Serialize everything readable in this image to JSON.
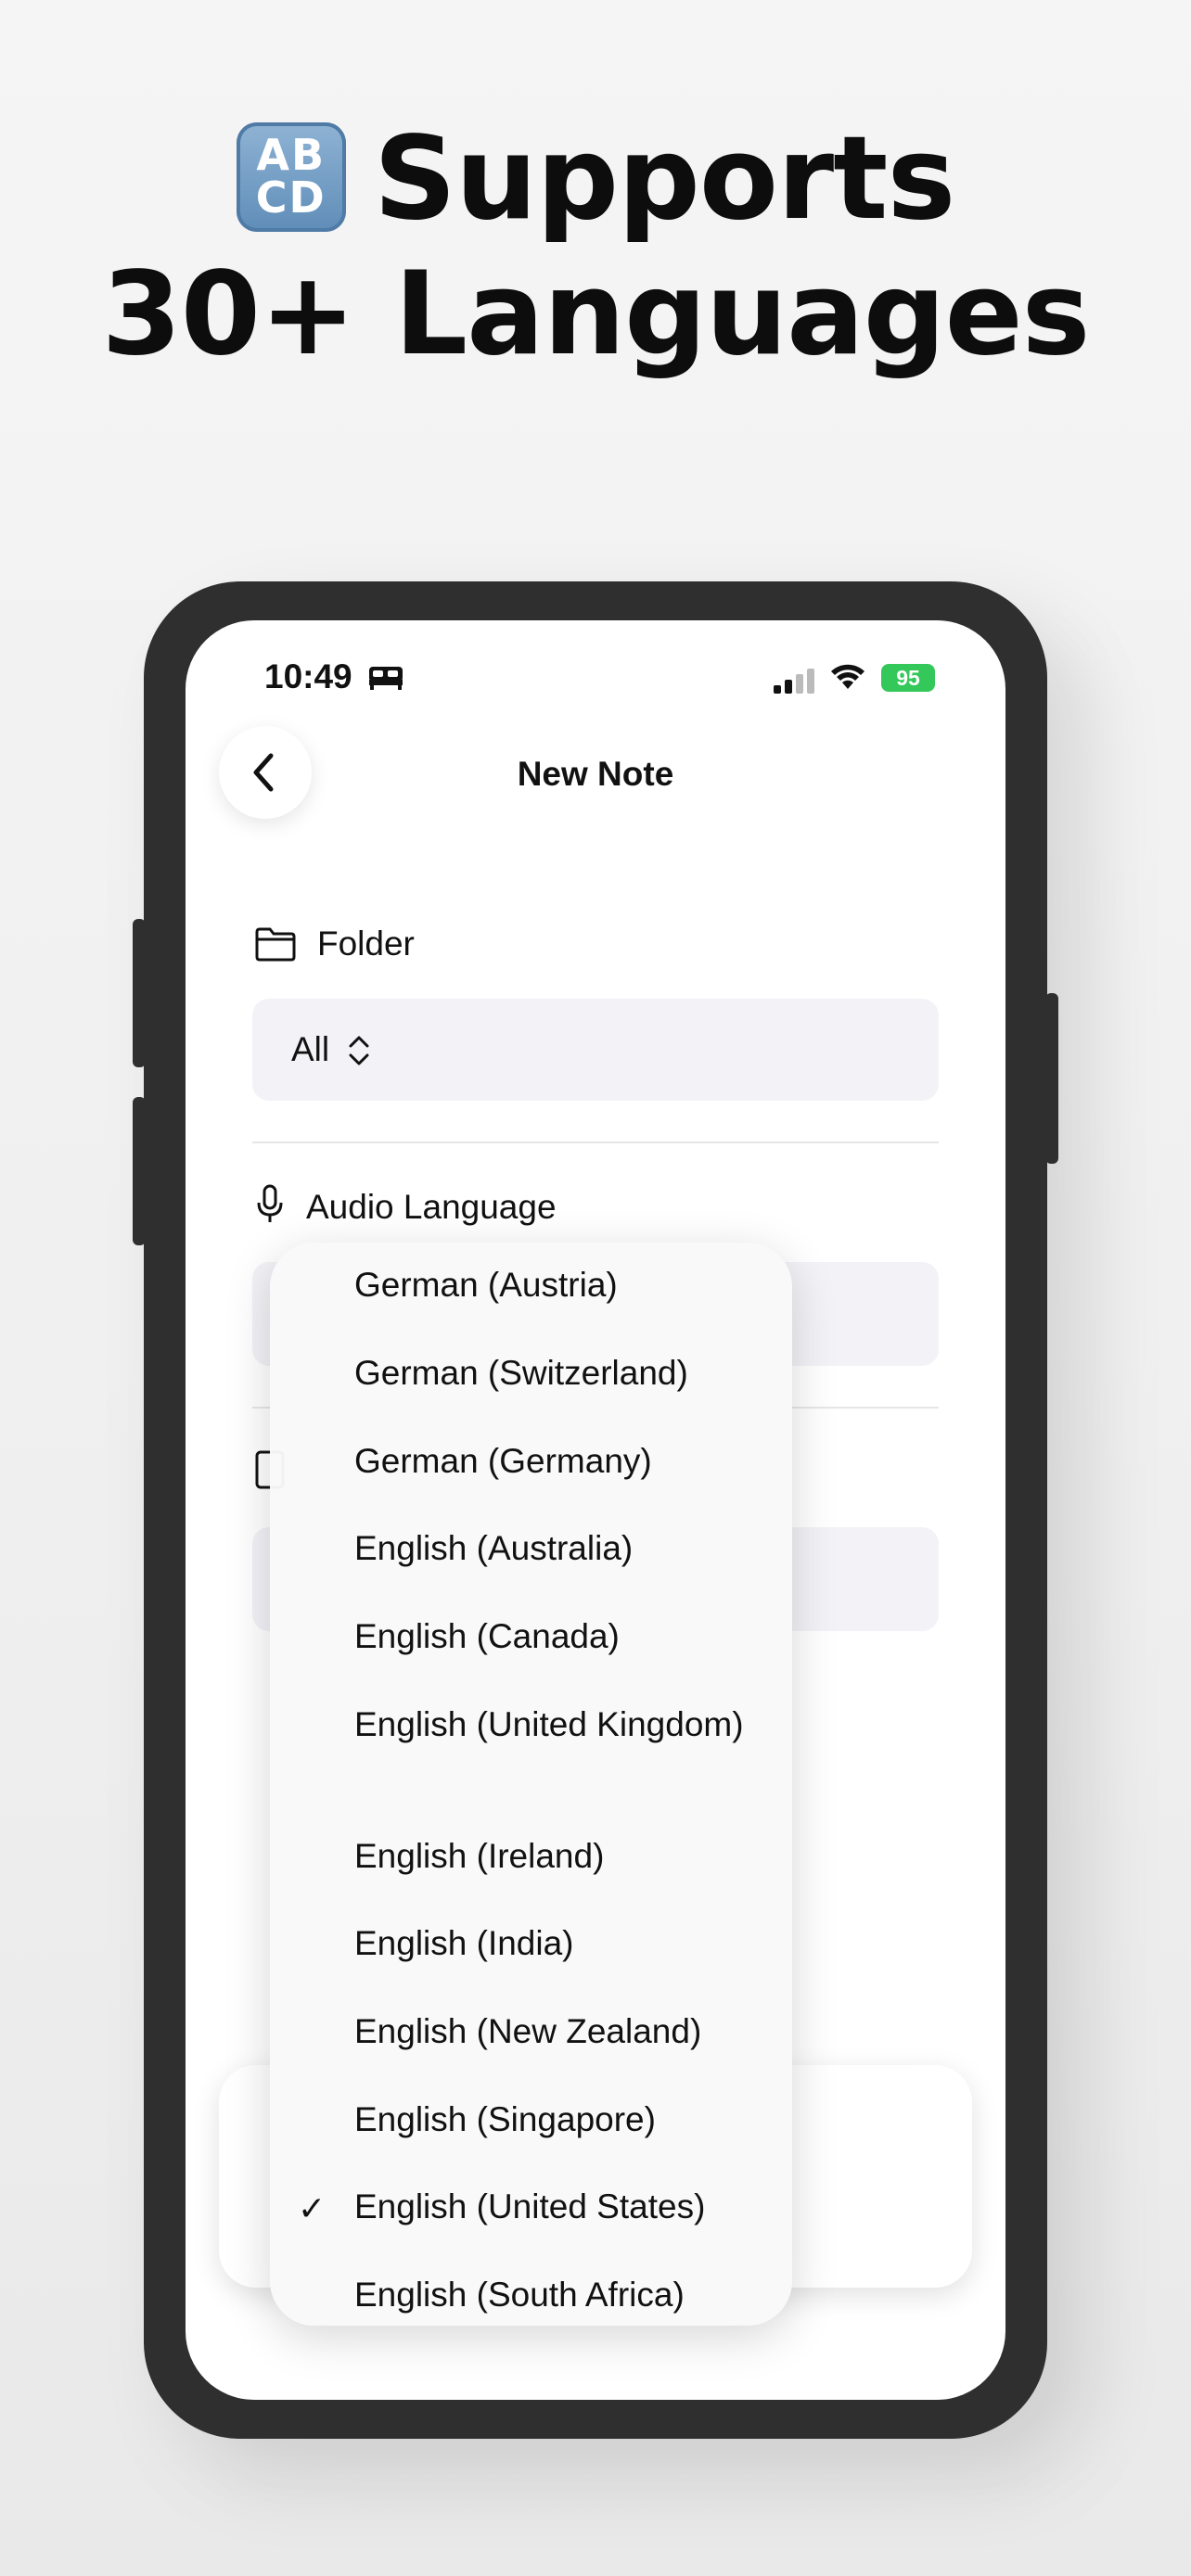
{
  "headline": {
    "badge_row1": "AB",
    "badge_row2": "CD",
    "line1": "Supports",
    "line2": "30+ Languages"
  },
  "status_bar": {
    "time": "10:49",
    "battery": "95"
  },
  "nav": {
    "title": "New Note"
  },
  "folder": {
    "label": "Folder",
    "value": "All"
  },
  "audio_language": {
    "label": "Audio Language"
  },
  "language_menu": {
    "items": [
      {
        "label": "German (Austria)",
        "selected": false
      },
      {
        "label": "German (Switzerland)",
        "selected": false
      },
      {
        "label": "German (Germany)",
        "selected": false
      },
      {
        "label": "English (Australia)",
        "selected": false
      },
      {
        "label": "English (Canada)",
        "selected": false
      },
      {
        "label": "English (United Kingdom)",
        "selected": false
      },
      {
        "label": "English (Ireland)",
        "selected": false
      },
      {
        "label": "English (India)",
        "selected": false
      },
      {
        "label": "English (New Zealand)",
        "selected": false
      },
      {
        "label": "English (Singapore)",
        "selected": false
      },
      {
        "label": "English (United States)",
        "selected": true
      },
      {
        "label": "English (South Africa)",
        "selected": false
      }
    ],
    "check_glyph": "✓"
  },
  "colors": {
    "battery": "#34c759",
    "field_bg": "#f2f2f7",
    "phone_frame": "#2f2f2f"
  }
}
